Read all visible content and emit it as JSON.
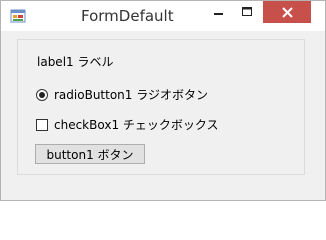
{
  "window": {
    "title": "FormDefault",
    "app_icon": "windows-form-icon",
    "controls": {
      "minimize_icon": "minimize-icon",
      "maximize_icon": "maximize-icon",
      "close_icon": "close-icon",
      "close_color": "#c7504a"
    }
  },
  "form": {
    "label1_text": "label1 ラベル",
    "radio_button1": {
      "label": "radioButton1 ラジオボタン",
      "checked": true
    },
    "check_box1": {
      "label": "checkBox1 チェックボックス",
      "checked": false
    },
    "button1_label": "button1 ボタン"
  }
}
